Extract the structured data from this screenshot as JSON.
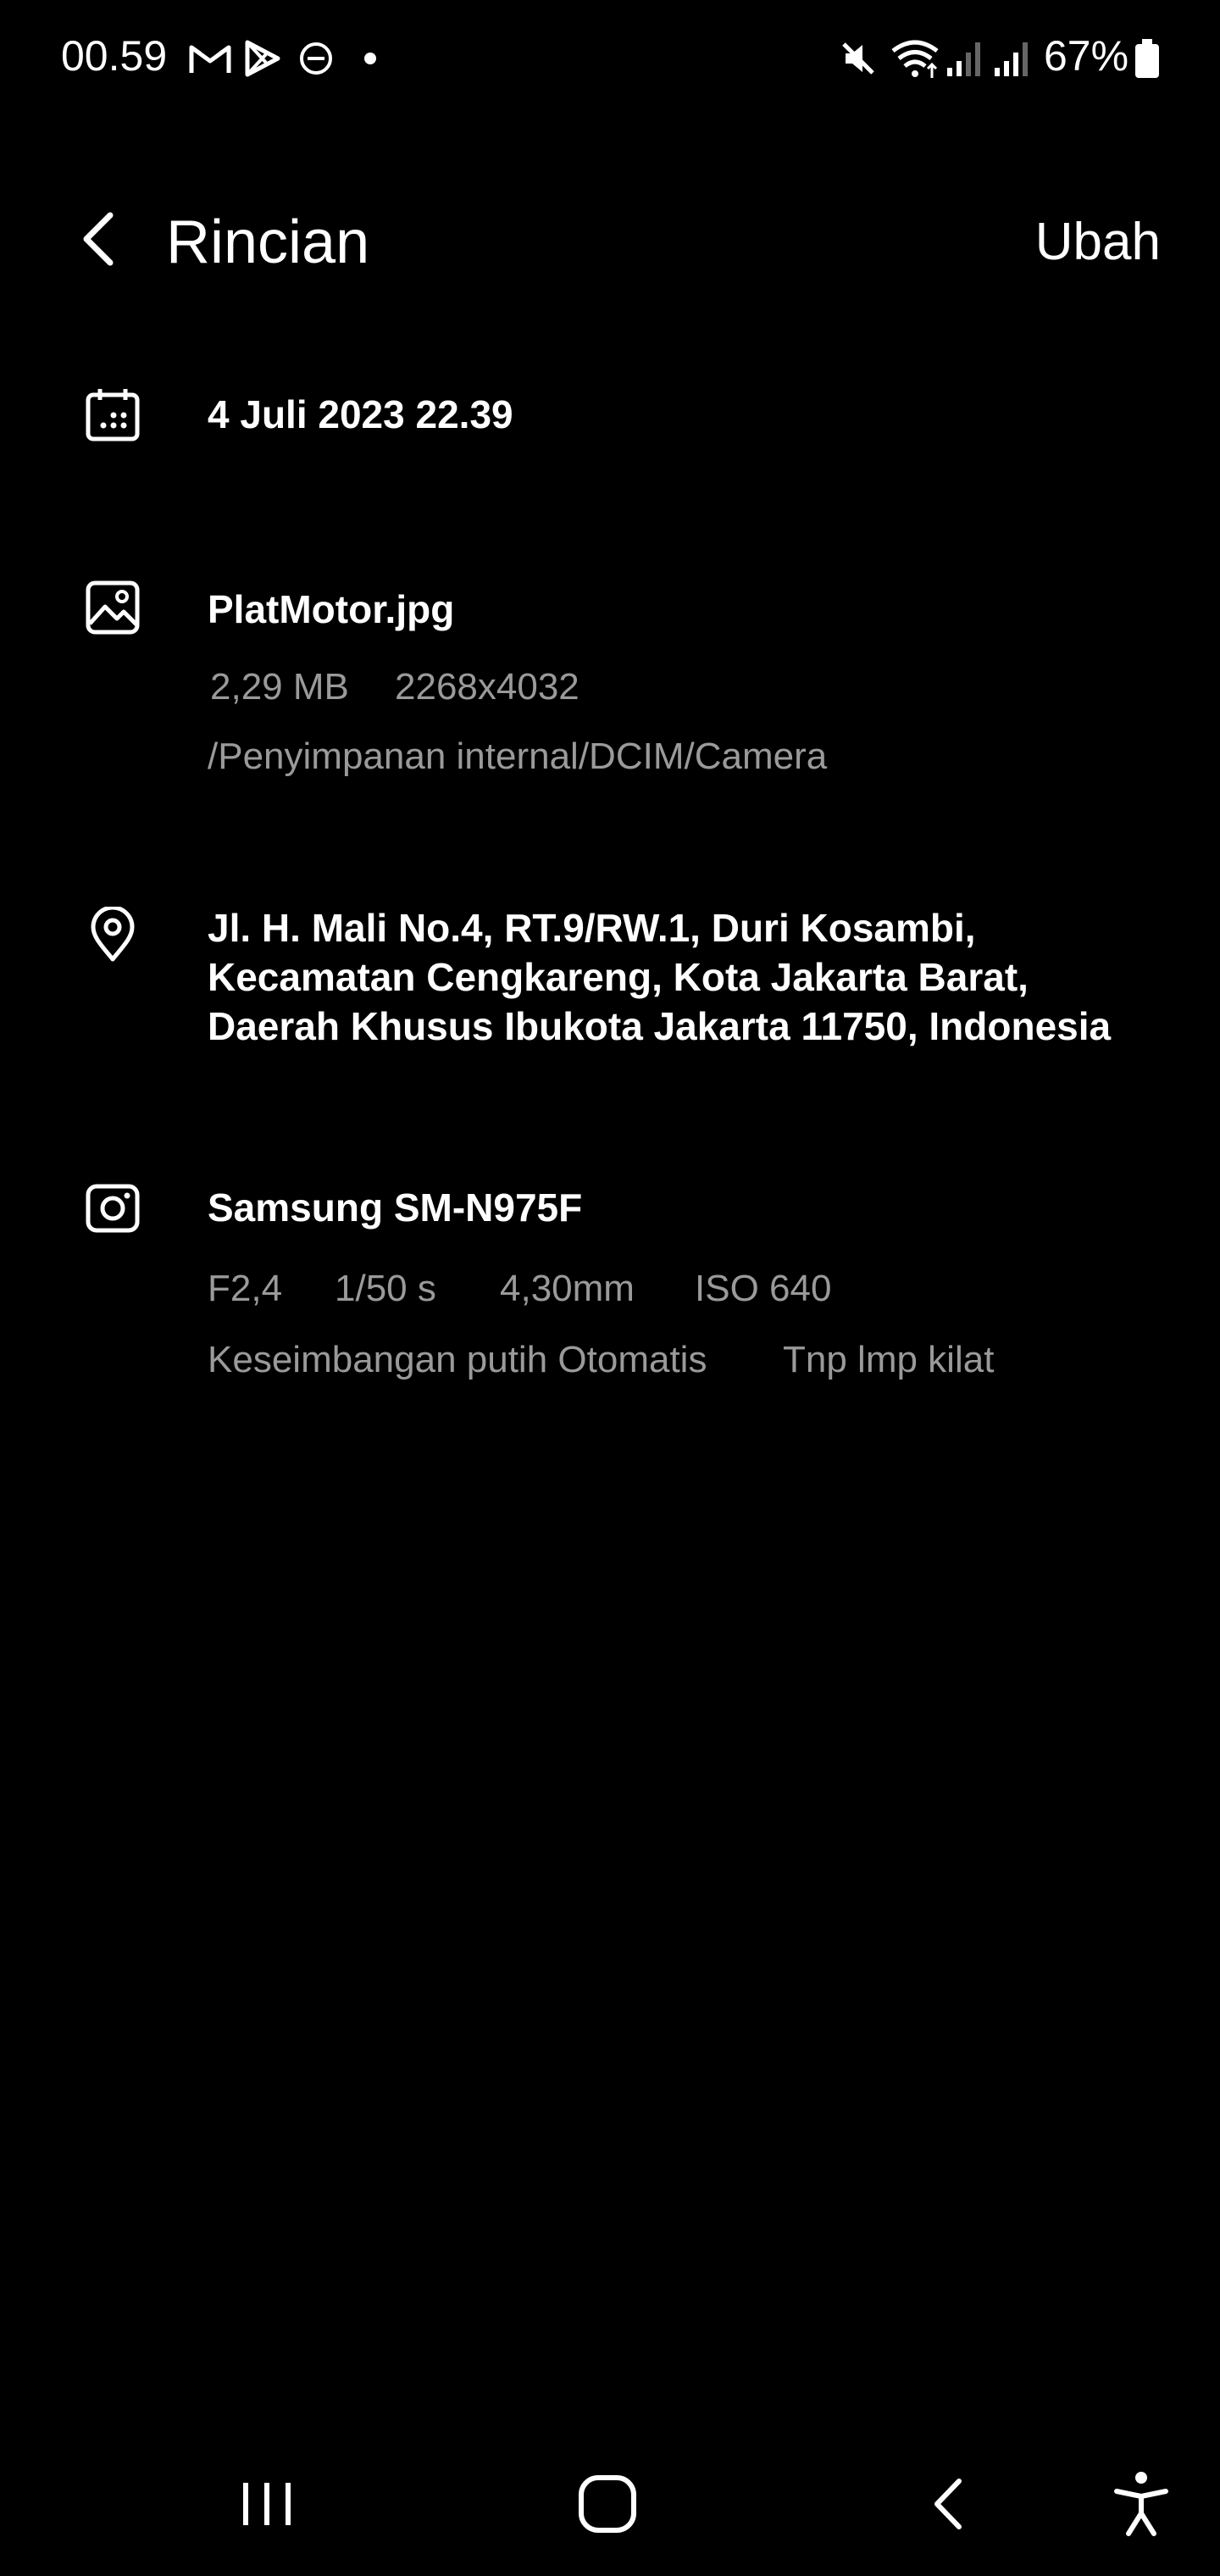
{
  "status_bar": {
    "time": "00.59",
    "notification_icons": [
      "gmail-icon",
      "play-store-icon",
      "do-not-disturb-icon",
      "dot-icon"
    ],
    "system_icons": [
      "mute-icon",
      "wifi-icon",
      "signal-icon",
      "signal-icon"
    ],
    "battery_percent": "67%"
  },
  "header": {
    "title": "Rincian",
    "edit_label": "Ubah"
  },
  "date_row": {
    "value": "4 Juli 2023 22.39"
  },
  "file_row": {
    "name": "PlatMotor.jpg",
    "size": "2,29 MB",
    "resolution": "2268x4032",
    "path": "/Penyimpanan internal/DCIM/Camera"
  },
  "location_row": {
    "line1": "Jl. H. Mali No.4, RT.9/RW.1, Duri Kosambi,",
    "line2": "Kecamatan Cengkareng, Kota Jakarta Barat,",
    "line3": "Daerah Khusus Ibukota Jakarta 11750, Indonesia"
  },
  "camera_row": {
    "model": "Samsung SM-N975F",
    "aperture": "F2,4",
    "shutter": "1/50 s",
    "focal_length": "4,30mm",
    "iso": "ISO 640",
    "white_balance": "Keseimbangan putih Otomatis",
    "flash": "Tnp lmp kilat"
  },
  "nav_bar": {
    "icons": [
      "recent-apps-icon",
      "home-icon",
      "back-icon",
      "accessibility-icon"
    ]
  }
}
